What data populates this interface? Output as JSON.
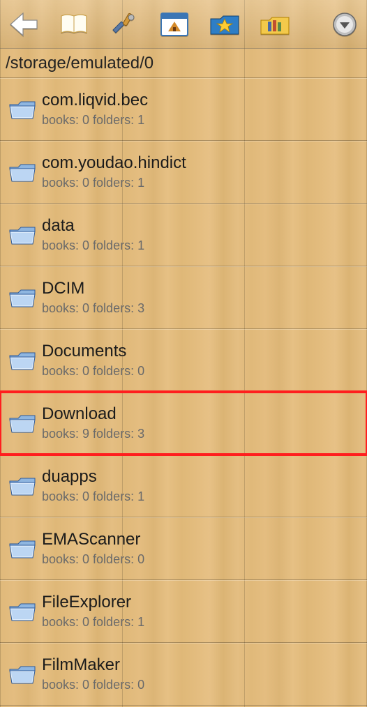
{
  "path": "/storage/emulated/0",
  "meta_books_label": "books:",
  "meta_folders_label": "folders:",
  "folders": [
    {
      "name": "com.liqvid.bec",
      "books": 0,
      "folders": 1,
      "highlight": false
    },
    {
      "name": "com.youdao.hindict",
      "books": 0,
      "folders": 1,
      "highlight": false
    },
    {
      "name": "data",
      "books": 0,
      "folders": 1,
      "highlight": false
    },
    {
      "name": "DCIM",
      "books": 0,
      "folders": 3,
      "highlight": false
    },
    {
      "name": "Documents",
      "books": 0,
      "folders": 0,
      "highlight": false
    },
    {
      "name": "Download",
      "books": 9,
      "folders": 3,
      "highlight": true
    },
    {
      "name": "duapps",
      "books": 0,
      "folders": 1,
      "highlight": false
    },
    {
      "name": "EMAScanner",
      "books": 0,
      "folders": 0,
      "highlight": false
    },
    {
      "name": "FileExplorer",
      "books": 0,
      "folders": 1,
      "highlight": false
    },
    {
      "name": "FilmMaker",
      "books": 0,
      "folders": 0,
      "highlight": false
    }
  ]
}
